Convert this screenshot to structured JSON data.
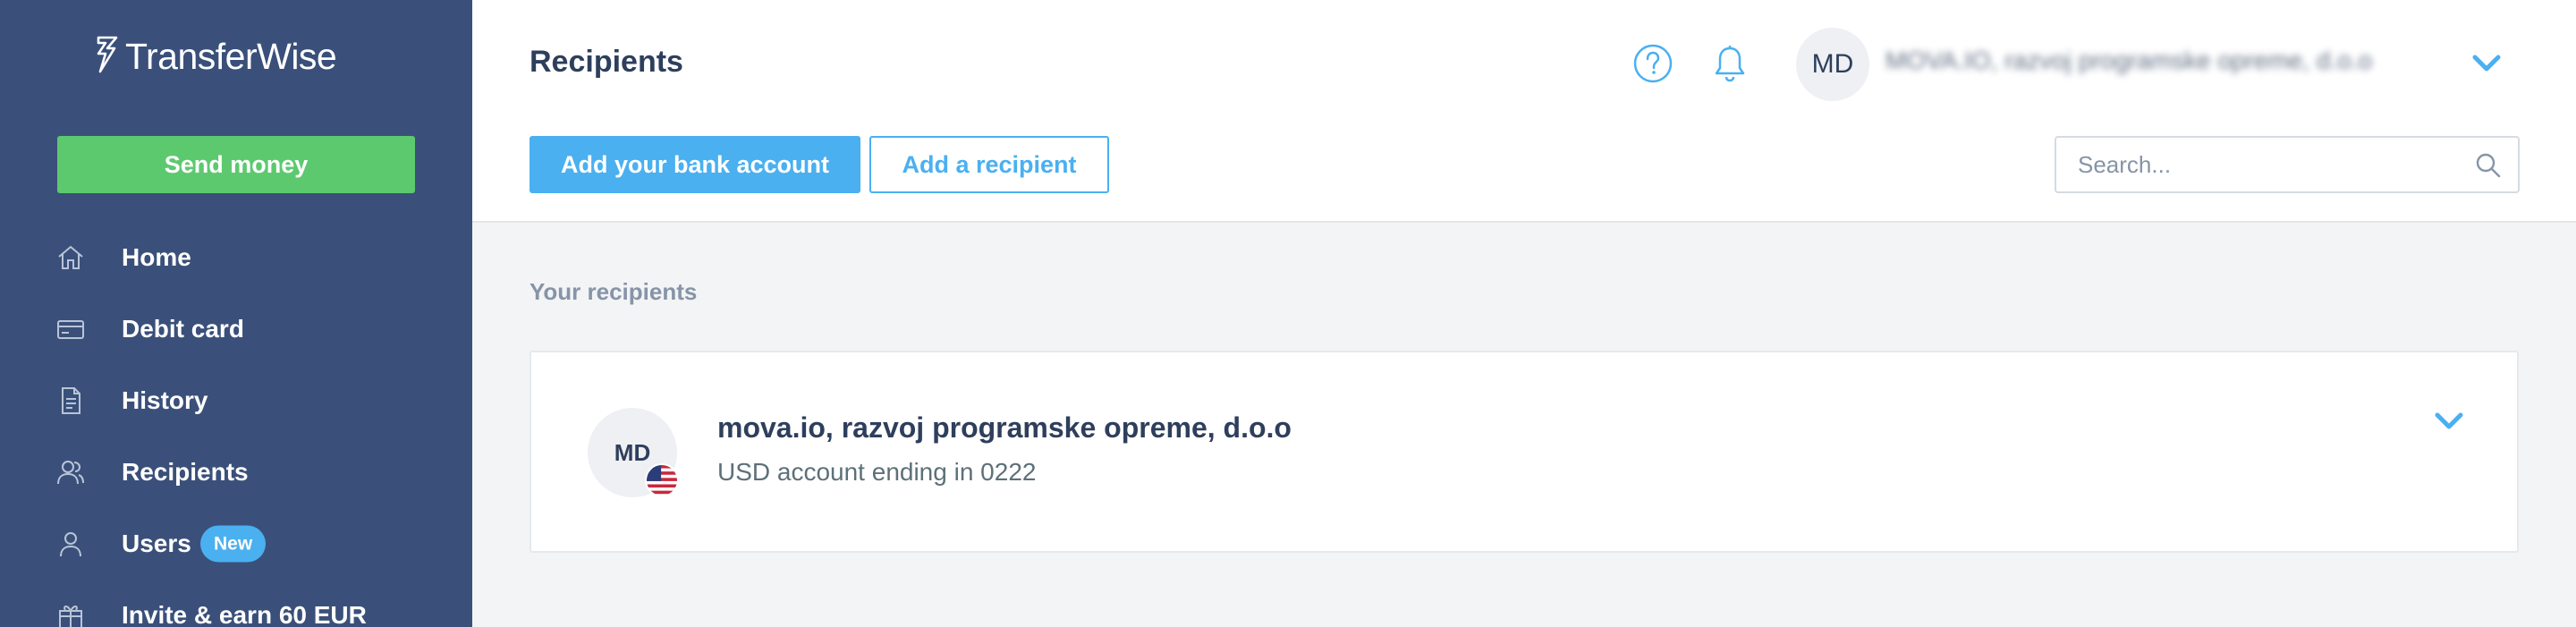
{
  "brand": {
    "name": "TransferWise"
  },
  "sidebar": {
    "send_button": "Send money",
    "items": [
      {
        "label": "Home",
        "icon": "home-icon"
      },
      {
        "label": "Debit card",
        "icon": "card-icon"
      },
      {
        "label": "History",
        "icon": "document-icon"
      },
      {
        "label": "Recipients",
        "icon": "recipients-icon"
      },
      {
        "label": "Users",
        "icon": "user-icon",
        "badge": "New"
      },
      {
        "label": "Invite & earn 60 EUR",
        "icon": "gift-icon"
      }
    ]
  },
  "header": {
    "title": "Recipients",
    "avatar_initials": "MD",
    "account_name": "MOVA.IO, razvoj programske opreme, d.o.o",
    "add_bank_button": "Add your bank account",
    "add_recipient_button": "Add a recipient",
    "search_placeholder": "Search..."
  },
  "main": {
    "section_title": "Your recipients",
    "recipients": [
      {
        "initials": "MD",
        "name": "mova.io, razvoj programske opreme, d.o.o",
        "detail": "USD account ending in 0222",
        "currency_flag": "us-flag-icon"
      }
    ]
  },
  "colors": {
    "sidebar_bg": "#3a507a",
    "accent_blue": "#4ab0f0",
    "send_green": "#5dc96f",
    "text_dark": "#2e3f5c"
  }
}
